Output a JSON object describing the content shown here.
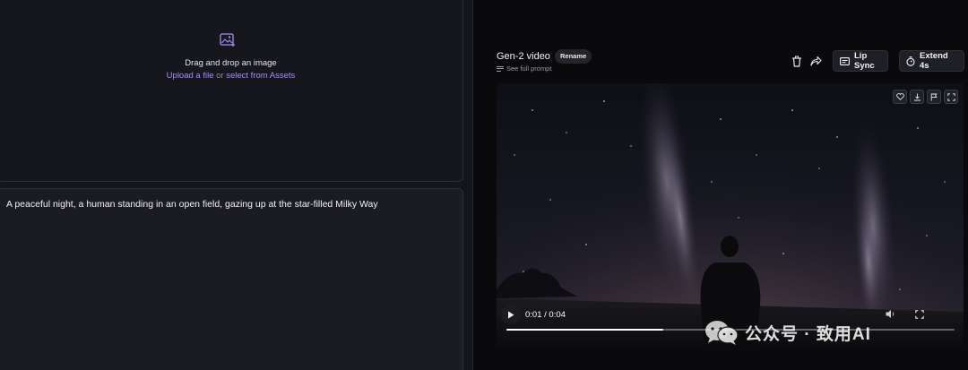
{
  "upload": {
    "icon": "image-upload-icon",
    "drag_text": "Drag and drop an image",
    "upload_link": "Upload a file",
    "or_text": "or",
    "assets_link": "select from Assets"
  },
  "prompt": {
    "text": "A peaceful night, a human standing in an open field, gazing up at the star-filled Milky Way"
  },
  "video_header": {
    "title": "Gen-2 video",
    "rename_label": "Rename",
    "see_prompt_label": "See full prompt",
    "lip_sync_label": "Lip Sync",
    "extend_label": "Extend 4s"
  },
  "player": {
    "time": "0:01 / 0:04",
    "progress": 0.35
  },
  "watermark": {
    "text": "公众号 · 致用AI"
  },
  "colors": {
    "accent_link": "#a78bfa",
    "panel_bg": "#15161b",
    "page_bg": "#0a0a0c"
  }
}
